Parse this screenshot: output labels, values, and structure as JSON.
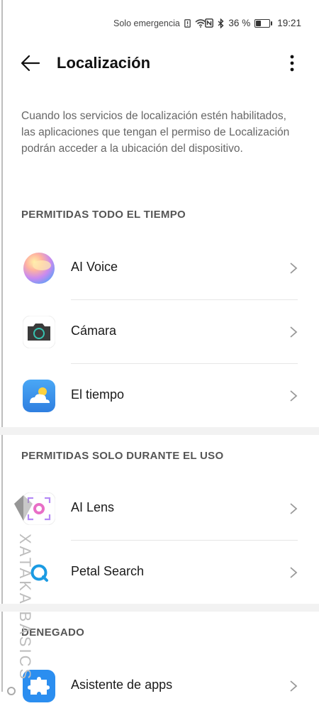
{
  "status_bar": {
    "carrier": "Solo emergencia",
    "battery": "36 %",
    "time": "19:21"
  },
  "app_bar": {
    "title": "Localización"
  },
  "intro_text": "Cuando los servicios de localización estén habilitados, las aplicaciones que tengan el permiso de Localización podrán acceder a la ubicación del dispositivo.",
  "sections": [
    {
      "header": "PERMITIDAS TODO EL TIEMPO",
      "items": [
        {
          "label": "AI Voice",
          "icon": "ai-voice-icon"
        },
        {
          "label": "Cámara",
          "icon": "camera-icon"
        },
        {
          "label": "El tiempo",
          "icon": "weather-icon"
        }
      ]
    },
    {
      "header": "PERMITIDAS SOLO DURANTE EL USO",
      "items": [
        {
          "label": "AI Lens",
          "icon": "ai-lens-icon"
        },
        {
          "label": "Petal Search",
          "icon": "petal-search-icon"
        }
      ]
    },
    {
      "header": "DENEGADO",
      "items": [
        {
          "label": "Asistente de apps",
          "icon": "app-assistant-icon"
        }
      ]
    }
  ],
  "watermark": "XATAKA BASICS",
  "colors": {
    "accent": "#2f8be8",
    "background": "#ffffff",
    "section_band": "#f2f2f2"
  }
}
